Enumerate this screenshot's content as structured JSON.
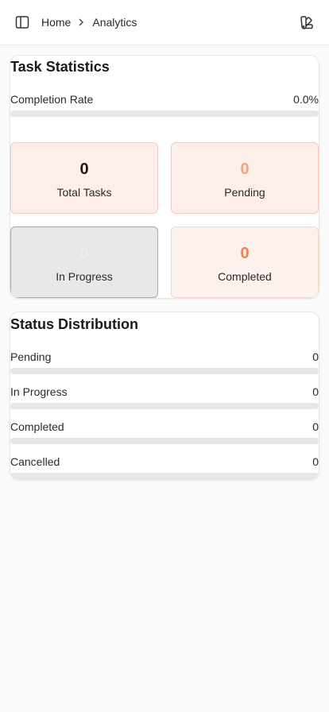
{
  "breadcrumb": {
    "home": "Home",
    "current": "Analytics"
  },
  "icons": {
    "sidebar_toggle": "sidebar-panel-icon",
    "separator": "chevron-right-icon",
    "theme": "theme-palette-icon"
  },
  "task_statistics": {
    "title": "Task Statistics",
    "completion_label": "Completion Rate",
    "completion_value": "0.0%",
    "completion_fraction": 0.0,
    "tiles": [
      {
        "count": "0",
        "label": "Total Tasks",
        "bg": "#fdeeea",
        "border": "#f5c9bd",
        "num_color": "#1a1a1a"
      },
      {
        "count": "0",
        "label": "Pending",
        "bg": "#fdeeea",
        "border": "#f5c9bd",
        "num_color": "#f4a27e"
      },
      {
        "count": "0",
        "label": "In Progress",
        "bg": "#e8e8e8",
        "border": "#a8a8a8",
        "num_color": "#eeeeee"
      },
      {
        "count": "0",
        "label": "Completed",
        "bg": "#fdf1ed",
        "border": "#f5d3c8",
        "num_color": "#f08050"
      }
    ]
  },
  "status_distribution": {
    "title": "Status Distribution",
    "rows": [
      {
        "label": "Pending",
        "value": "0",
        "fraction": 0
      },
      {
        "label": "In Progress",
        "value": "0",
        "fraction": 0
      },
      {
        "label": "Completed",
        "value": "0",
        "fraction": 0
      },
      {
        "label": "Cancelled",
        "value": "0",
        "fraction": 0
      }
    ]
  },
  "colors": {
    "accent": "#f08a5d",
    "track": "#e6e6e6"
  }
}
